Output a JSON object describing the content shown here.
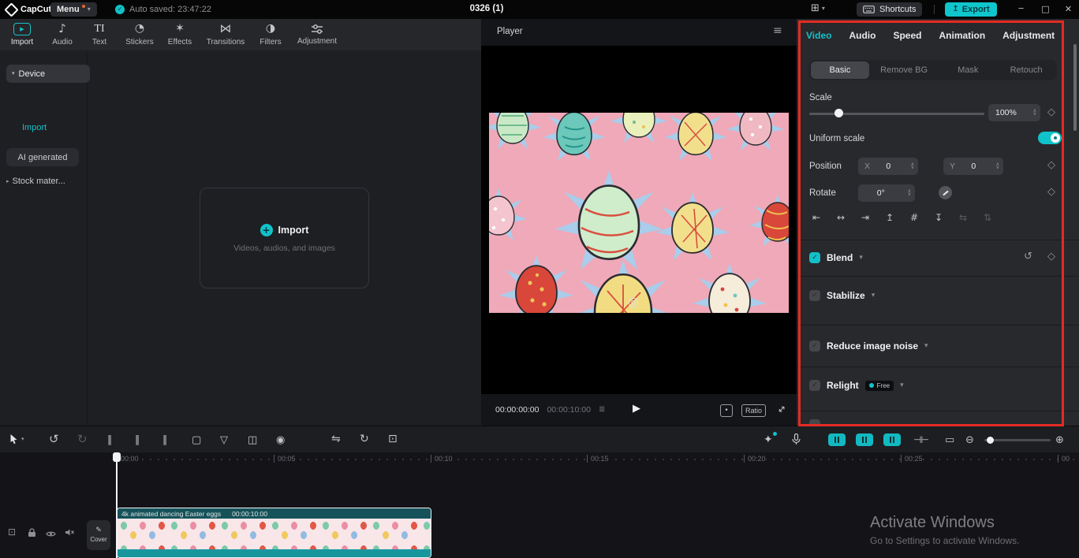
{
  "colors": {
    "accent": "#12c0c8",
    "annotation": "#e42b22"
  },
  "titlebar": {
    "app_name": "CapCut",
    "menu_label": "Menu",
    "autosave": "Auto saved: 23:47:22",
    "doc_title": "0326 (1)",
    "shortcuts_label": "Shortcuts",
    "export_label": "Export"
  },
  "media": {
    "tabs": [
      "Import",
      "Audio",
      "Text",
      "Stickers",
      "Effects",
      "Transitions",
      "Filters",
      "Adjustment"
    ],
    "sidebar": {
      "device": "Device",
      "import": "Import",
      "ai": "AI generated",
      "stock": "Stock mater..."
    },
    "import_card": {
      "title": "Import",
      "subtitle": "Videos, audios, and images"
    }
  },
  "player": {
    "title": "Player",
    "current_time": "00:00:00:00",
    "duration": "00:00:10:00",
    "ratio_label": "Ratio"
  },
  "inspector": {
    "tabs": [
      "Video",
      "Audio",
      "Speed",
      "Animation",
      "Adjustment"
    ],
    "active_tab": "Video",
    "subtabs": [
      "Basic",
      "Remove BG",
      "Mask",
      "Retouch"
    ],
    "scale": {
      "label": "Scale",
      "value": "100%"
    },
    "uniform_scale_label": "Uniform scale",
    "position": {
      "label": "Position",
      "x_label": "X",
      "x_value": "0",
      "y_label": "Y",
      "y_value": "0"
    },
    "rotate": {
      "label": "Rotate",
      "value": "0°"
    },
    "blend_label": "Blend",
    "stabilize_label": "Stabilize",
    "noise_label": "Reduce image noise",
    "relight_label": "Relight",
    "relight_badge": "Free"
  },
  "timeline": {
    "ruler_labels": [
      "00:00",
      "00:05",
      "00:10",
      "00:15",
      "00:20",
      "00:25",
      "00"
    ],
    "cover_label": "Cover",
    "clip": {
      "title": "4k animated dancing Easter eggs",
      "duration": "00:00:10:00"
    }
  },
  "watermark": {
    "line1": "Activate Windows",
    "line2": "Go to Settings to activate Windows."
  },
  "icons": {
    "check": "✓",
    "caret_down": "▾",
    "caret_right": "▸",
    "grid": "⊞",
    "minimize": "─",
    "maximize": "□",
    "close": "✕",
    "export_arrow": "↥",
    "hamburger": "≡",
    "play": "▶",
    "note": "♪",
    "sticker": "◔",
    "effects": "✶",
    "transitions": "⋈",
    "filters": "◑",
    "text_tab": "TI",
    "plus": "+",
    "undo": "↺",
    "redo": "↻",
    "split": "∥",
    "trash": "▢",
    "mask": "▽",
    "overlay": "◫",
    "record": "◉",
    "mirror": "⇋",
    "rotate_tool": "↻",
    "crop": "⊡",
    "wand": "✦",
    "handles": "⊣⊢",
    "monitor": "▭",
    "zoom_out": "⊖",
    "zoom_fit": "⊕",
    "step_up": "∧",
    "step_down": "∨",
    "diamond": "◇",
    "reset": "↺",
    "dropdown": "▾",
    "frames": "≣",
    "pencil": "✎",
    "dot": "•",
    "diag": "↔",
    "watermark_circle": "◎",
    "screen": "⊡",
    "align": [
      "⇤",
      "↔",
      "⇥",
      "↥",
      "#",
      "↧",
      "⇆",
      "⇅"
    ]
  }
}
